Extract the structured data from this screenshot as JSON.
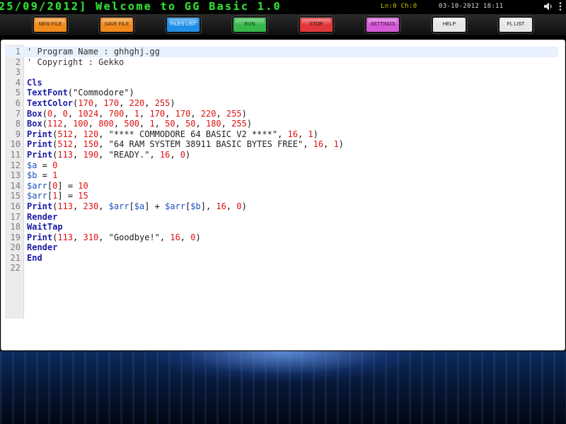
{
  "header": {
    "marquee": "25/09/2012] Welcome to GG Basic 1.0",
    "line_col": "Ln:0 Ch:0",
    "datetime": "03-10-2012 18:11",
    "icons": [
      "speaker-icon",
      "menu-dots-icon"
    ]
  },
  "toolbar": {
    "buttons": [
      {
        "id": "new-file",
        "label": "NEW FILE",
        "color": "#f08a1c",
        "text_color": "#3a1a00"
      },
      {
        "id": "save-file",
        "label": "SAVE FILE",
        "color": "#f08a1c",
        "text_color": "#3a1a00"
      },
      {
        "id": "files-list",
        "label": "FILES LIST",
        "color": "#1f8fe8",
        "text_color": "#ffffff"
      },
      {
        "id": "run",
        "label": "RUN",
        "color": "#36b84a",
        "text_color": "#0a3a10"
      },
      {
        "id": "stop",
        "label": "STOP",
        "color": "#e0383a",
        "text_color": "#3a0000"
      },
      {
        "id": "settings",
        "label": "SETTINGS",
        "color": "#d45ad6",
        "text_color": "#3a003a"
      },
      {
        "id": "help",
        "label": "HELP",
        "color": "#e6e6e6",
        "text_color": "#111111"
      },
      {
        "id": "fl-list",
        "label": "FL LIST",
        "color": "#e6e6e6",
        "text_color": "#111111"
      }
    ]
  },
  "editor": {
    "active_line": 1,
    "lines": [
      {
        "n": "1",
        "tokens": [
          [
            "comment",
            "' Program Name : ghhghj.gg"
          ]
        ]
      },
      {
        "n": "2",
        "tokens": [
          [
            "comment",
            "' Copyright : Gekko"
          ]
        ]
      },
      {
        "n": "3",
        "tokens": []
      },
      {
        "n": "4",
        "tokens": [
          [
            "keyword",
            "Cls"
          ]
        ]
      },
      {
        "n": "5",
        "tokens": [
          [
            "keyword",
            "TextFont"
          ],
          [
            "op",
            "("
          ],
          [
            "string",
            "\"Commodore\""
          ],
          [
            "op",
            ")"
          ]
        ]
      },
      {
        "n": "6",
        "tokens": [
          [
            "keyword",
            "TextColor"
          ],
          [
            "op",
            "("
          ],
          [
            "number",
            "170"
          ],
          [
            "op",
            ", "
          ],
          [
            "number",
            "170"
          ],
          [
            "op",
            ", "
          ],
          [
            "number",
            "220"
          ],
          [
            "op",
            ", "
          ],
          [
            "number",
            "255"
          ],
          [
            "op",
            ")"
          ]
        ]
      },
      {
        "n": "7",
        "tokens": [
          [
            "keyword",
            "Box"
          ],
          [
            "op",
            "("
          ],
          [
            "number",
            "0"
          ],
          [
            "op",
            ", "
          ],
          [
            "number",
            "0"
          ],
          [
            "op",
            ", "
          ],
          [
            "number",
            "1024"
          ],
          [
            "op",
            ", "
          ],
          [
            "number",
            "700"
          ],
          [
            "op",
            ", "
          ],
          [
            "number",
            "1"
          ],
          [
            "op",
            ", "
          ],
          [
            "number",
            "170"
          ],
          [
            "op",
            ", "
          ],
          [
            "number",
            "170"
          ],
          [
            "op",
            ", "
          ],
          [
            "number",
            "220"
          ],
          [
            "op",
            ", "
          ],
          [
            "number",
            "255"
          ],
          [
            "op",
            ")"
          ]
        ]
      },
      {
        "n": "8",
        "tokens": [
          [
            "keyword",
            "Box"
          ],
          [
            "op",
            "("
          ],
          [
            "number",
            "112"
          ],
          [
            "op",
            ", "
          ],
          [
            "number",
            "100"
          ],
          [
            "op",
            ", "
          ],
          [
            "number",
            "800"
          ],
          [
            "op",
            ", "
          ],
          [
            "number",
            "500"
          ],
          [
            "op",
            ", "
          ],
          [
            "number",
            "1"
          ],
          [
            "op",
            ", "
          ],
          [
            "number",
            "50"
          ],
          [
            "op",
            ", "
          ],
          [
            "number",
            "50"
          ],
          [
            "op",
            ", "
          ],
          [
            "number",
            "180"
          ],
          [
            "op",
            ", "
          ],
          [
            "number",
            "255"
          ],
          [
            "op",
            ")"
          ]
        ]
      },
      {
        "n": "9",
        "tokens": [
          [
            "keyword",
            "Print"
          ],
          [
            "op",
            "("
          ],
          [
            "number",
            "512"
          ],
          [
            "op",
            ", "
          ],
          [
            "number",
            "120"
          ],
          [
            "op",
            ", "
          ],
          [
            "string",
            "\"**** COMMODORE 64 BASIC V2 ****\""
          ],
          [
            "op",
            ", "
          ],
          [
            "number",
            "16"
          ],
          [
            "op",
            ", "
          ],
          [
            "number",
            "1"
          ],
          [
            "op",
            ")"
          ]
        ]
      },
      {
        "n": "10",
        "tokens": [
          [
            "keyword",
            "Print"
          ],
          [
            "op",
            "("
          ],
          [
            "number",
            "512"
          ],
          [
            "op",
            ", "
          ],
          [
            "number",
            "150"
          ],
          [
            "op",
            ", "
          ],
          [
            "string",
            "\"64 RAM SYSTEM 38911 BASIC BYTES FREE\""
          ],
          [
            "op",
            ", "
          ],
          [
            "number",
            "16"
          ],
          [
            "op",
            ", "
          ],
          [
            "number",
            "1"
          ],
          [
            "op",
            ")"
          ]
        ]
      },
      {
        "n": "11",
        "tokens": [
          [
            "keyword",
            "Print"
          ],
          [
            "op",
            "("
          ],
          [
            "number",
            "113"
          ],
          [
            "op",
            ", "
          ],
          [
            "number",
            "190"
          ],
          [
            "op",
            ", "
          ],
          [
            "string",
            "\"READY.\""
          ],
          [
            "op",
            ", "
          ],
          [
            "number",
            "16"
          ],
          [
            "op",
            ", "
          ],
          [
            "number",
            "0"
          ],
          [
            "op",
            ")"
          ]
        ]
      },
      {
        "n": "12",
        "tokens": [
          [
            "var",
            "$a"
          ],
          [
            "op",
            " = "
          ],
          [
            "number",
            "0"
          ]
        ]
      },
      {
        "n": "13",
        "tokens": [
          [
            "var",
            "$b"
          ],
          [
            "op",
            " = "
          ],
          [
            "number",
            "1"
          ]
        ]
      },
      {
        "n": "14",
        "tokens": [
          [
            "var",
            "$arr"
          ],
          [
            "op",
            "["
          ],
          [
            "number",
            "0"
          ],
          [
            "op",
            "] = "
          ],
          [
            "number",
            "10"
          ]
        ]
      },
      {
        "n": "15",
        "tokens": [
          [
            "var",
            "$arr"
          ],
          [
            "op",
            "["
          ],
          [
            "number",
            "1"
          ],
          [
            "op",
            "] = "
          ],
          [
            "number",
            "15"
          ]
        ]
      },
      {
        "n": "16",
        "tokens": [
          [
            "keyword",
            "Print"
          ],
          [
            "op",
            "("
          ],
          [
            "number",
            "113"
          ],
          [
            "op",
            ", "
          ],
          [
            "number",
            "230"
          ],
          [
            "op",
            ", "
          ],
          [
            "var",
            "$arr"
          ],
          [
            "op",
            "["
          ],
          [
            "var",
            "$a"
          ],
          [
            "op",
            "] + "
          ],
          [
            "var",
            "$arr"
          ],
          [
            "op",
            "["
          ],
          [
            "var",
            "$b"
          ],
          [
            "op",
            "], "
          ],
          [
            "number",
            "16"
          ],
          [
            "op",
            ", "
          ],
          [
            "number",
            "0"
          ],
          [
            "op",
            ")"
          ]
        ]
      },
      {
        "n": "17",
        "tokens": [
          [
            "keyword",
            "Render"
          ]
        ]
      },
      {
        "n": "18",
        "tokens": [
          [
            "keyword",
            "WaitTap"
          ]
        ]
      },
      {
        "n": "19",
        "tokens": [
          [
            "keyword",
            "Print"
          ],
          [
            "op",
            "("
          ],
          [
            "number",
            "113"
          ],
          [
            "op",
            ", "
          ],
          [
            "number",
            "310"
          ],
          [
            "op",
            ", "
          ],
          [
            "string",
            "\"Goodbye!\""
          ],
          [
            "op",
            ", "
          ],
          [
            "number",
            "16"
          ],
          [
            "op",
            ", "
          ],
          [
            "number",
            "0"
          ],
          [
            "op",
            ")"
          ]
        ]
      },
      {
        "n": "20",
        "tokens": [
          [
            "keyword",
            "Render"
          ]
        ]
      },
      {
        "n": "21",
        "tokens": [
          [
            "keyword",
            "End"
          ]
        ]
      },
      {
        "n": "22",
        "tokens": []
      }
    ]
  },
  "colors": {
    "marquee_green": "#33dd33",
    "status_yellow": "#ccc300",
    "keyword_blue": "#1a1aa6",
    "number_red": "#e01010",
    "active_line_bg": "#e8f2fe"
  }
}
